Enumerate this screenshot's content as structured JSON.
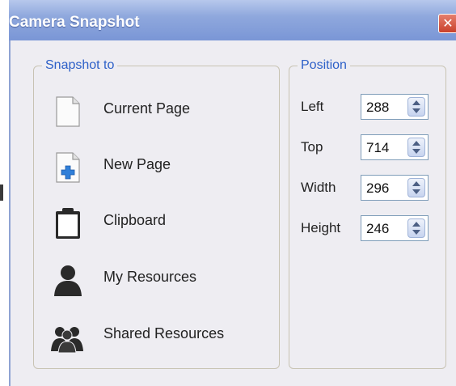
{
  "window": {
    "title": "Camera Snapshot",
    "close_glyph": "✕"
  },
  "snapshot": {
    "legend": "Snapshot to",
    "items": [
      {
        "label": "Current Page",
        "icon": "blank-page-icon"
      },
      {
        "label": "New Page",
        "icon": "new-page-icon"
      },
      {
        "label": "Clipboard",
        "icon": "clipboard-icon"
      },
      {
        "label": "My Resources",
        "icon": "person-icon"
      },
      {
        "label": "Shared Resources",
        "icon": "people-icon"
      }
    ]
  },
  "position": {
    "legend": "Position",
    "fields": [
      {
        "label": "Left",
        "value": "288"
      },
      {
        "label": "Top",
        "value": "714"
      },
      {
        "label": "Width",
        "value": "296"
      },
      {
        "label": "Height",
        "value": "246"
      }
    ]
  },
  "colors": {
    "accent": "#2d60c8",
    "titlebar": "#7a96d6",
    "close": "#c9412b"
  }
}
